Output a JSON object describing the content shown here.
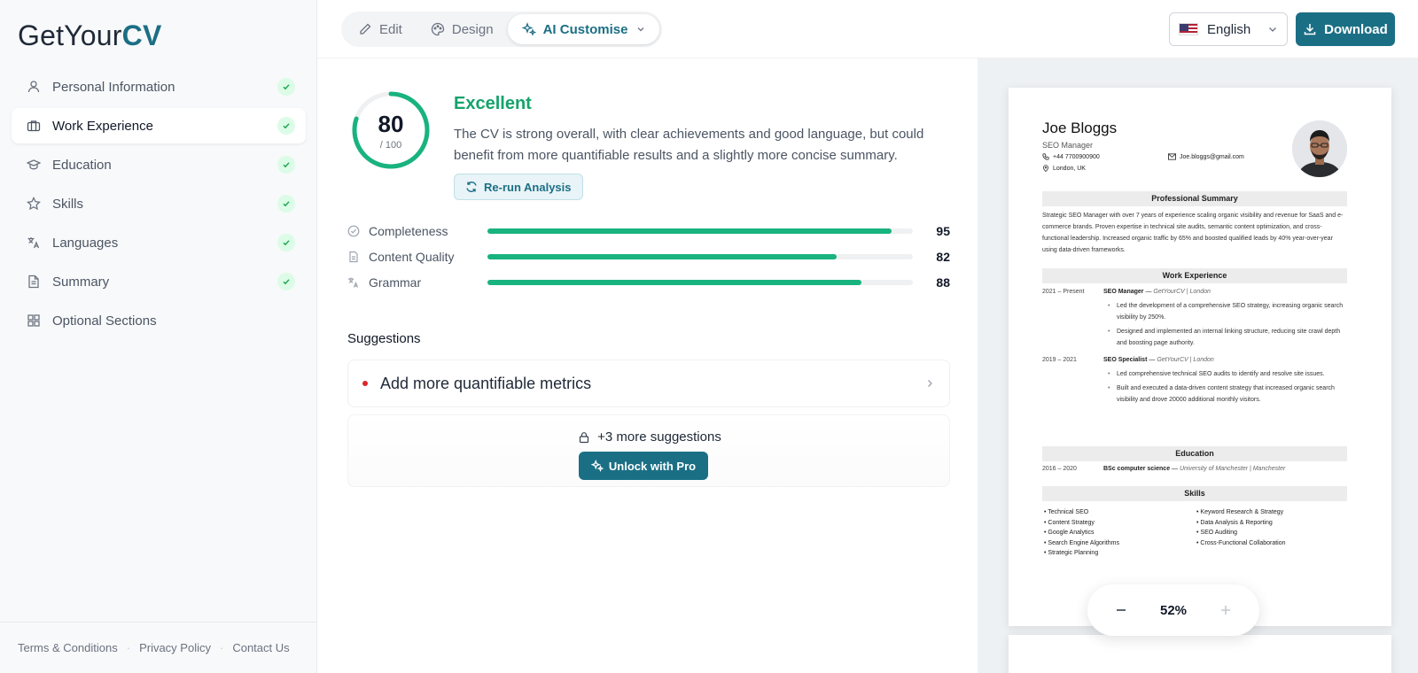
{
  "logo": {
    "prefix": "GetYour",
    "accent": "CV"
  },
  "sidebar": {
    "items": [
      {
        "label": "Personal Information",
        "icon": "user-icon",
        "done": true
      },
      {
        "label": "Work Experience",
        "icon": "briefcase-icon",
        "done": true,
        "active": true
      },
      {
        "label": "Education",
        "icon": "graduation-cap-icon",
        "done": true
      },
      {
        "label": "Skills",
        "icon": "star-icon",
        "done": true
      },
      {
        "label": "Languages",
        "icon": "translate-icon",
        "done": true
      },
      {
        "label": "Summary",
        "icon": "document-icon",
        "done": true
      },
      {
        "label": "Optional Sections",
        "icon": "grid-icon",
        "done": false
      }
    ],
    "footer": [
      "Terms & Conditions",
      "Privacy Policy",
      "Contact Us"
    ]
  },
  "tabs": [
    {
      "label": "Edit",
      "icon": "pencil-icon"
    },
    {
      "label": "Design",
      "icon": "palette-icon"
    },
    {
      "label": "AI Customise",
      "icon": "sparkles-icon",
      "active": true
    }
  ],
  "language": {
    "label": "English",
    "flag": "us-flag-icon"
  },
  "download_label": "Download",
  "analysis": {
    "score": "80",
    "score_max": "/ 100",
    "score_value": 80,
    "rating": "Excellent",
    "description": "The CV is strong overall, with clear achievements and good language, but could benefit from more quantifiable results and a slightly more concise summary.",
    "rerun_label": "Re-run Analysis",
    "metrics": [
      {
        "label": "Completeness",
        "value": "95",
        "percent": 95
      },
      {
        "label": "Content Quality",
        "value": "82",
        "percent": 82
      },
      {
        "label": "Grammar",
        "value": "88",
        "percent": 88
      }
    ]
  },
  "suggestions": {
    "title": "Suggestions",
    "items": [
      "Add more quantifiable metrics"
    ],
    "locked_text": "+3 more suggestions",
    "unlock_label": "Unlock with Pro"
  },
  "cv": {
    "name": "Joe Bloggs",
    "title": "SEO Manager",
    "phone": "+44 7700900900",
    "email": "Joe.bloggs@gmail.com",
    "location": "London, UK",
    "summary_heading": "Professional Summary",
    "summary": "Strategic SEO Manager with over 7 years of experience scaling organic visibility and revenue for SaaS and e-commerce brands. Proven expertise in technical site audits, semantic content optimization, and cross-functional leadership. Increased organic traffic by 65% and boosted qualified leads by 40% year-over-year using data-driven frameworks.",
    "work_heading": "Work Experience",
    "jobs": [
      {
        "dates": "2021 – Present",
        "role": "SEO Manager",
        "company": "GetYourCV | London",
        "bullets": [
          "Led the development of a comprehensive SEO strategy, increasing organic search visibility by 250%.",
          "Designed and implemented an internal linking structure, reducing site crawl depth and boosting page authority."
        ]
      },
      {
        "dates": "2019 – 2021",
        "role": "SEO Specialist",
        "company": "GetYourCV | London",
        "bullets": [
          "Led comprehensive technical SEO audits to identify and resolve site issues.",
          "Built and executed a data-driven content strategy that increased organic search visibility and drove 20000 additional monthly visitors."
        ]
      }
    ],
    "education_heading": "Education",
    "education": {
      "dates": "2016 – 2020",
      "degree": "BSc computer science",
      "school": "University of Manchester | Manchester"
    },
    "skills_heading": "Skills",
    "skills_left": [
      "Technical SEO",
      "Content Strategy",
      "Google Analytics",
      "Search Engine Algorithms",
      "Strategic Planning"
    ],
    "skills_right": [
      "Keyword Research & Strategy",
      "Data Analysis & Reporting",
      "SEO Auditing",
      "Cross-Functional Collaboration"
    ]
  },
  "zoom": {
    "value": "52%"
  },
  "colors": {
    "brand": "#1b6f85",
    "success": "#18b37e",
    "rating": "#15a36b",
    "alert": "#dc2626"
  }
}
